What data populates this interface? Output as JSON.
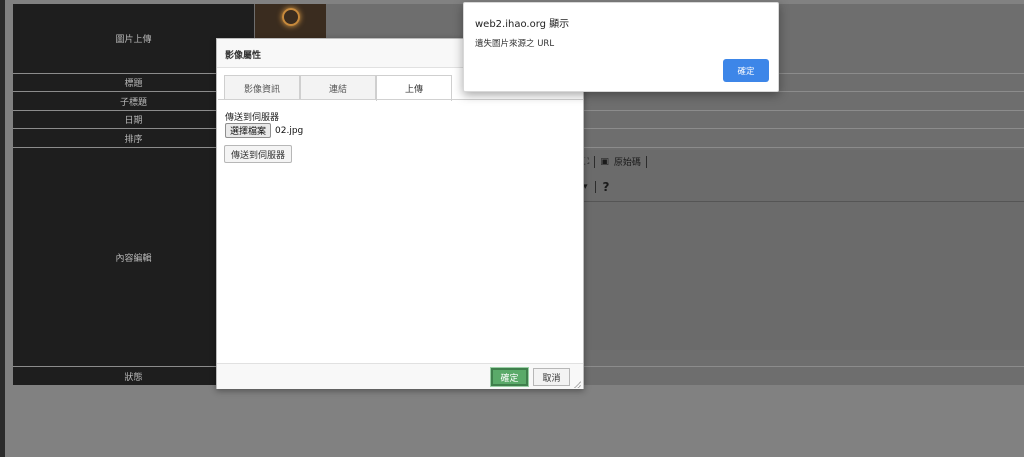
{
  "form": {
    "labels": {
      "image_upload": "圖片上傳",
      "title": "標題",
      "subtitle": "子標題",
      "date": "日期",
      "order": "排序",
      "content_editor": "內容編輯",
      "status": "狀態"
    }
  },
  "editor": {
    "source_label": "原始碼",
    "help_glyph": "?"
  },
  "dialog": {
    "title": "影像屬性",
    "tabs": [
      {
        "label": "影像資訊",
        "active": false
      },
      {
        "label": "連結",
        "active": false
      },
      {
        "label": "上傳",
        "active": true
      }
    ],
    "upload": {
      "section_label": "傳送到伺服器",
      "choose_file_label": "選擇檔案",
      "file_name": "02.jpg",
      "send_button_label": "傳送到伺服器"
    },
    "footer": {
      "ok_label": "確定",
      "cancel_label": "取消"
    }
  },
  "alert": {
    "title": "web2.ihao.org 顯示",
    "message": "遺失圖片來源之 URL",
    "ok_label": "確定"
  },
  "colors": {
    "alert_button": "#3d86e8",
    "dialog_ok_button": "#5aaa69"
  }
}
